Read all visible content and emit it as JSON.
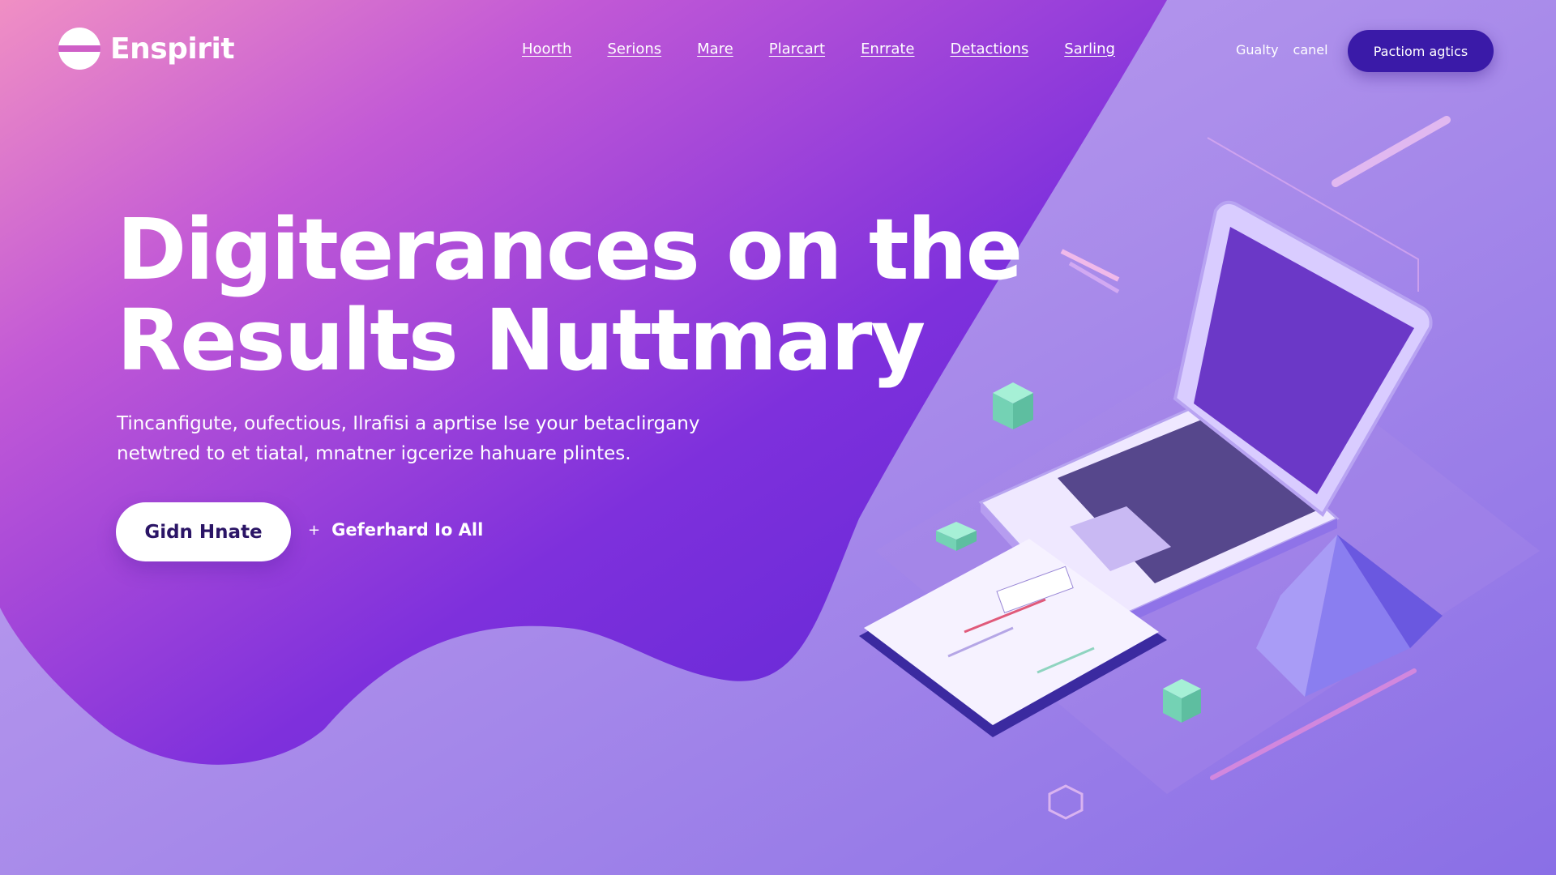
{
  "brand": {
    "name": "Enspirit"
  },
  "nav": {
    "items": [
      "Hoorth",
      "Serions",
      "Mare",
      "Plarcart",
      "Enrrate",
      "Detactions",
      "Sarling"
    ]
  },
  "header": {
    "aux_links": [
      "Gualty",
      "canel"
    ],
    "cta_label": "Pactiom agtics"
  },
  "hero": {
    "title_lines": [
      "Digiterances on the",
      "Results Nuttmary"
    ],
    "subtitle_lines": [
      "Tincanfigute, oufectious, Ilrafisi a aprtise Ise your betacIirgany",
      "netwtred to et tiatal, mnatner igcerize hahuare plintes."
    ],
    "primary_button": "Gidn Hnate",
    "secondary_link": "Geferhard Io All"
  },
  "colors": {
    "accent_dark": "#3a1aa8",
    "blob_pink": "#e07ad0",
    "blob_purple": "#6a2fd8",
    "mint": "#7fe3c4"
  }
}
